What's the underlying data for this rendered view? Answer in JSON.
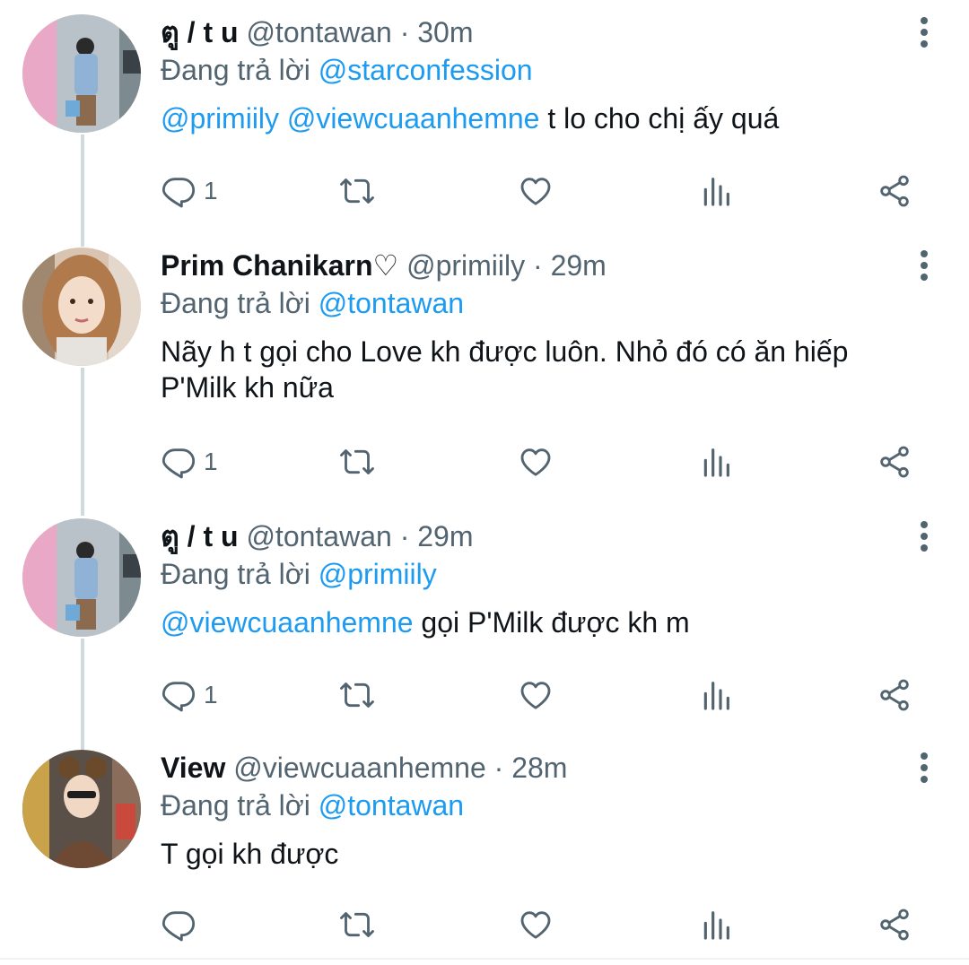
{
  "tweets": [
    {
      "name": "ตู / t u",
      "handle": "@tontawan",
      "time": "30m",
      "reply_prefix": "Đang trả lời",
      "reply_to": "@starconfession",
      "mentions": "@primiily @viewcuaanhemne",
      "text": " t lo cho chị ấy quá",
      "reply_count": "1",
      "avatar_icon": "user-avatar-photo"
    },
    {
      "name": "Prim Chanikarn♡",
      "handle": "@primiily",
      "time": "29m",
      "reply_prefix": "Đang trả lời",
      "reply_to": "@tontawan",
      "mentions": "",
      "text": "Nãy h t gọi cho Love kh được luôn. Nhỏ đó có ăn hiếp P'Milk kh nữa",
      "reply_count": "1",
      "avatar_icon": "user-avatar-photo"
    },
    {
      "name": "ตู / t u",
      "handle": "@tontawan",
      "time": "29m",
      "reply_prefix": "Đang trả lời",
      "reply_to": "@primiily",
      "mentions": "@viewcuaanhemne",
      "text": " gọi P'Milk được kh m",
      "reply_count": "1",
      "avatar_icon": "user-avatar-photo"
    },
    {
      "name": "View",
      "handle": "@viewcuaanhemne",
      "time": "28m",
      "reply_prefix": "Đang trả lời",
      "reply_to": "@tontawan",
      "mentions": "",
      "text": "T gọi kh được",
      "reply_count": "",
      "avatar_icon": "user-avatar-photo"
    }
  ],
  "separator": "·",
  "colors": {
    "link": "#1d9bf0",
    "secondary": "#536471",
    "thread_line": "#cfd9de"
  }
}
